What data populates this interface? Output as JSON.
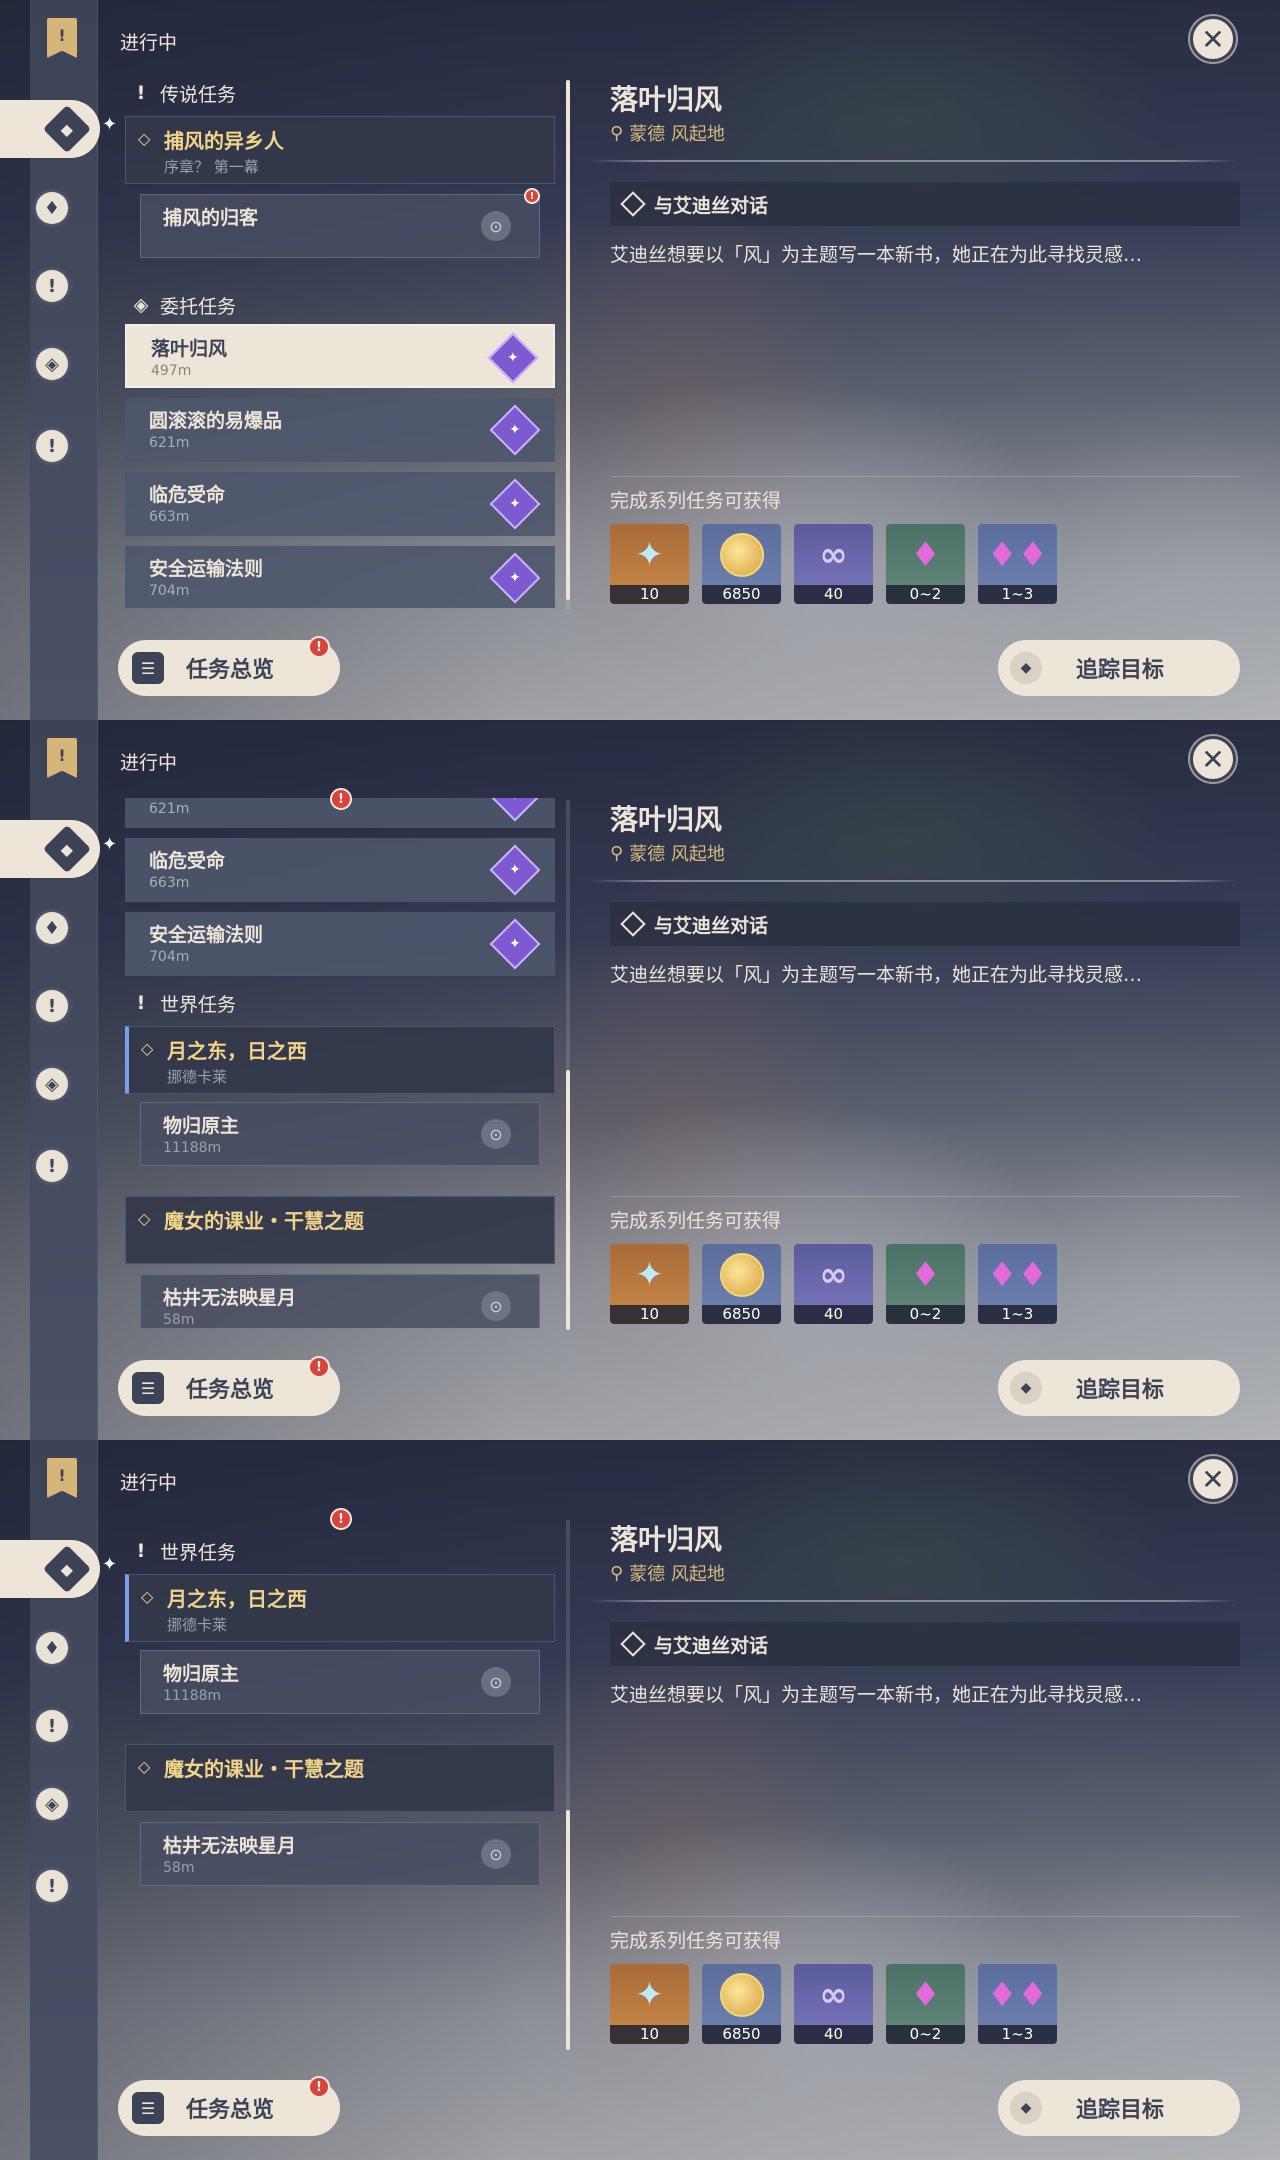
{
  "header": {
    "in_progress": "进行中"
  },
  "nav": {
    "book": "!",
    "items": [
      "!",
      "!",
      "!"
    ]
  },
  "categories": {
    "legend": "传说任务",
    "commission": "委托任务",
    "world": "世界任务"
  },
  "quests": {
    "legend_main": {
      "title": "捕风的异乡人",
      "sub": "序章？ 第一幕"
    },
    "legend_sub": {
      "title": "捕风的归客"
    },
    "commissions": [
      {
        "title": "落叶归风",
        "dist": "497m"
      },
      {
        "title": "圆滚滚的易爆品",
        "dist": "621m"
      },
      {
        "title": "临危受命",
        "dist": "663m"
      },
      {
        "title": "安全运输法则",
        "dist": "704m"
      }
    ],
    "world_main1": {
      "title": "月之东，日之西",
      "sub": "挪德卡莱"
    },
    "world_sub1": {
      "title": "物归原主",
      "dist": "11188m"
    },
    "world_main2": {
      "title": "魔女的课业・干慧之题"
    },
    "world_sub2": {
      "title": "枯井无法映星月",
      "dist": "58m"
    }
  },
  "buttons": {
    "overview": "任务总览",
    "track": "追踪目标",
    "alert": "!"
  },
  "detail": {
    "title": "落叶归风",
    "location": "蒙德 风起地",
    "objective": "与艾迪丝对话",
    "description": "艾迪丝想要以「风」为主题写一本新书，她正在为此寻找灵感…",
    "reward_label": "完成系列任务可获得",
    "rewards": [
      {
        "name": "primogem-icon",
        "amount": "10"
      },
      {
        "name": "mora-icon",
        "amount": "6850"
      },
      {
        "name": "adventure-exp-icon",
        "amount": "40"
      },
      {
        "name": "crystal-chunk-icon",
        "amount": "0~2"
      },
      {
        "name": "crystal-cluster-icon",
        "amount": "1~3"
      }
    ]
  },
  "close": "✕"
}
